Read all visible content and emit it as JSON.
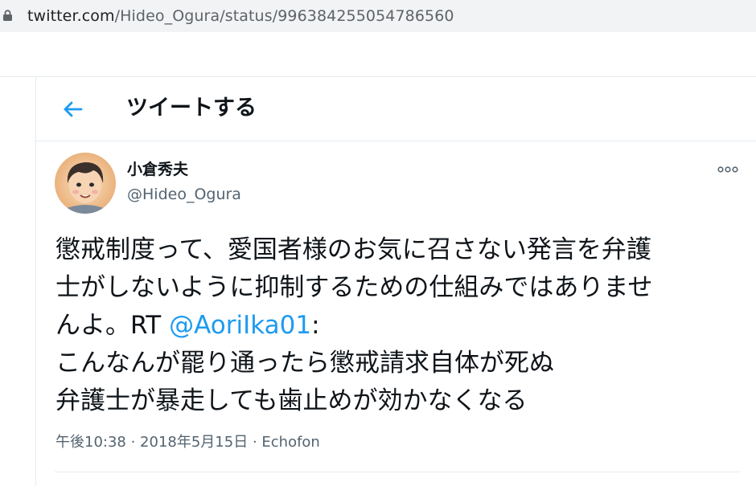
{
  "browser": {
    "url_host": "twitter.com",
    "url_path": "/Hideo_Ogura/status/996384255054786560"
  },
  "header": {
    "back_icon": "arrow-left-icon",
    "title": "ツイートする"
  },
  "tweet": {
    "author_name": "小倉秀夫",
    "author_handle": "@Hideo_Ogura",
    "more_icon": "more-horizontal-icon",
    "text_lines": {
      "line1": "懲戒制度って、愛国者様のお気に召さない発言を弁護",
      "line2": "士がしないように抑制するための仕組みではありませ",
      "line3_before": "んよ。RT ",
      "line3_mention": "@AoriIka01",
      "line3_after": ":",
      "line4": "こんなんが罷り通ったら懲戒請求自体が死ぬ",
      "line5": "弁護士が暴走しても歯止めが効かなくなる"
    },
    "time": "午後10:38",
    "separator1": " · ",
    "date": "2018年5月15日",
    "separator2": " · ",
    "source": "Echofon"
  },
  "colors": {
    "accent": "#1d9bf0",
    "secondary_text": "#536471",
    "divider": "#e6ecf0",
    "url_bar": "#f1f3f4"
  }
}
